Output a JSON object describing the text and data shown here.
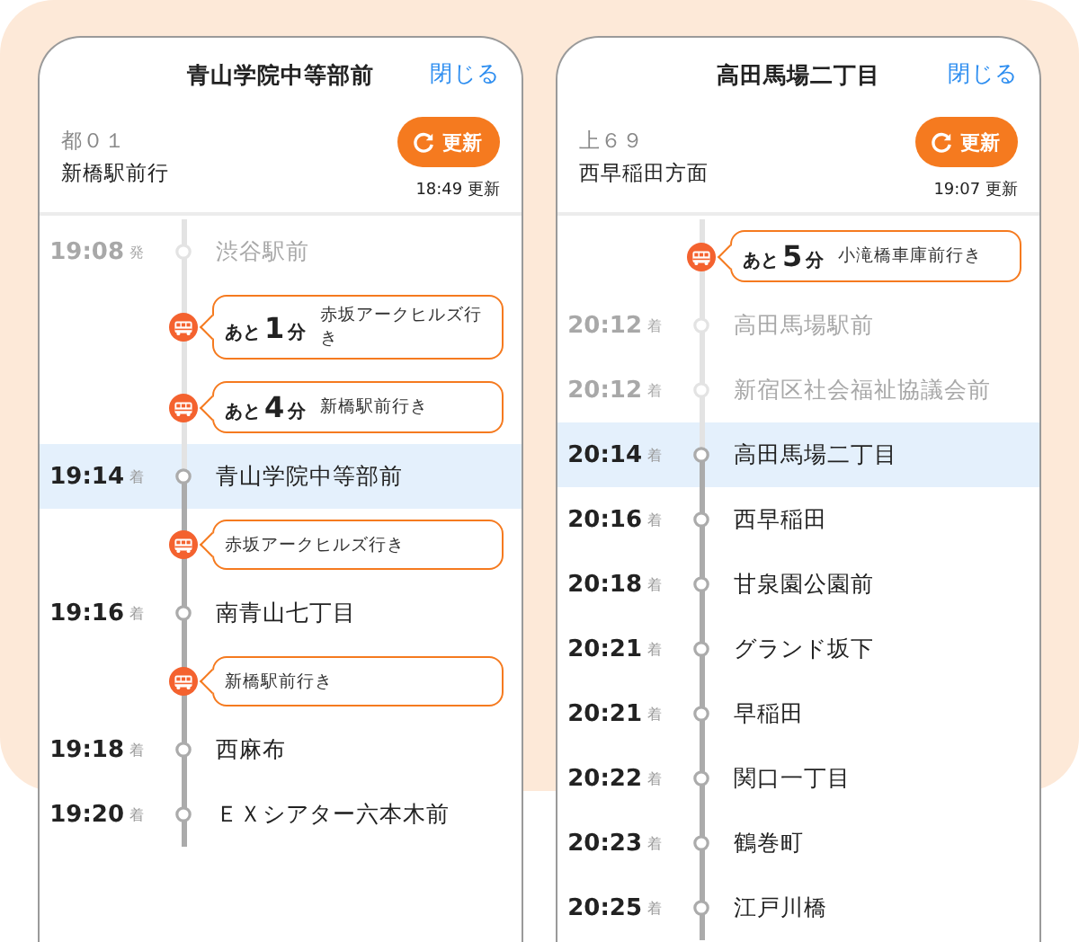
{
  "panels": [
    {
      "title": "青山学院中等部前",
      "close": "閉じる",
      "route": "都０１",
      "direction": "新橋駅前行",
      "refresh": "更新",
      "updated": "18:49 更新",
      "timeline": [
        {
          "kind": "stop",
          "time": "19:08",
          "mark": "発",
          "name": "渋谷駅前",
          "selected": false
        },
        {
          "kind": "bus",
          "countdown": {
            "before": "あと",
            "minutes": "1",
            "after": "分"
          },
          "destination": "赤坂アークヒルズ行き"
        },
        {
          "kind": "bus",
          "countdown": {
            "before": "あと",
            "minutes": "4",
            "after": "分"
          },
          "destination": "新橋駅前行き"
        },
        {
          "kind": "stop",
          "time": "19:14",
          "mark": "着",
          "name": "青山学院中等部前",
          "selected": true
        },
        {
          "kind": "bus",
          "destination": "赤坂アークヒルズ行き"
        },
        {
          "kind": "stop",
          "time": "19:16",
          "mark": "着",
          "name": "南青山七丁目",
          "selected": false
        },
        {
          "kind": "bus",
          "destination": "新橋駅前行き"
        },
        {
          "kind": "stop",
          "time": "19:18",
          "mark": "着",
          "name": "西麻布",
          "selected": false
        },
        {
          "kind": "stop",
          "time": "19:20",
          "mark": "着",
          "name": "ＥＸシアター六本木前",
          "selected": false
        }
      ]
    },
    {
      "title": "高田馬場二丁目",
      "close": "閉じる",
      "route": "上６９",
      "direction": "西早稲田方面",
      "refresh": "更新",
      "updated": "19:07 更新",
      "timeline": [
        {
          "kind": "bus",
          "countdown": {
            "before": "あと",
            "minutes": "5",
            "after": "分"
          },
          "destination": "小滝橋車庫前行き"
        },
        {
          "kind": "stop",
          "time": "20:12",
          "mark": "着",
          "name": "高田馬場駅前",
          "selected": false
        },
        {
          "kind": "stop",
          "time": "20:12",
          "mark": "着",
          "name": "新宿区社会福祉協議会前",
          "selected": false
        },
        {
          "kind": "stop",
          "time": "20:14",
          "mark": "着",
          "name": "高田馬場二丁目",
          "selected": true
        },
        {
          "kind": "stop",
          "time": "20:16",
          "mark": "着",
          "name": "西早稲田",
          "selected": false
        },
        {
          "kind": "stop",
          "time": "20:18",
          "mark": "着",
          "name": "甘泉園公園前",
          "selected": false
        },
        {
          "kind": "stop",
          "time": "20:21",
          "mark": "着",
          "name": "グランド坂下",
          "selected": false
        },
        {
          "kind": "stop",
          "time": "20:21",
          "mark": "着",
          "name": "早稲田",
          "selected": false
        },
        {
          "kind": "stop",
          "time": "20:22",
          "mark": "着",
          "name": "関口一丁目",
          "selected": false
        },
        {
          "kind": "stop",
          "time": "20:23",
          "mark": "着",
          "name": "鶴巻町",
          "selected": false
        },
        {
          "kind": "stop",
          "time": "20:25",
          "mark": "着",
          "name": "江戸川橋",
          "selected": false
        }
      ]
    }
  ]
}
